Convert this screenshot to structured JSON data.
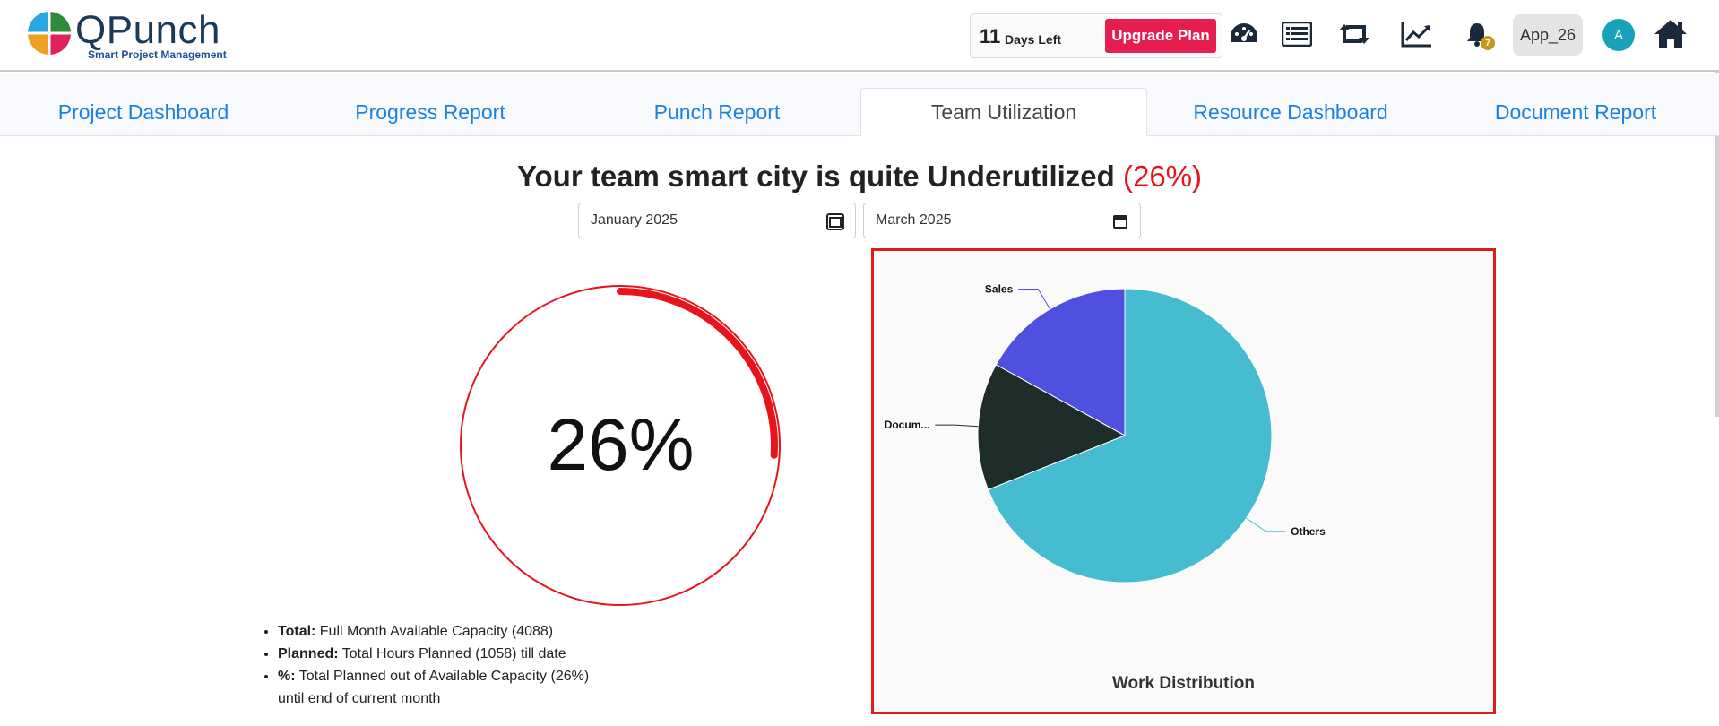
{
  "brand": {
    "name": "QPunch",
    "tagline": "Smart Project Management"
  },
  "trial": {
    "days": "11",
    "days_label": "Days Left",
    "upgrade_label": "Upgrade Plan"
  },
  "header_icons": [
    "dashboard-gauge-icon",
    "list-icon",
    "retweet-icon",
    "trend-chart-icon",
    "bell-icon",
    "home-icon"
  ],
  "notifications": {
    "count": "7"
  },
  "app": {
    "name": "App_26"
  },
  "user": {
    "initial": "A"
  },
  "tabs": [
    {
      "label": "Project Dashboard",
      "active": false
    },
    {
      "label": "Progress Report",
      "active": false
    },
    {
      "label": "Punch Report",
      "active": false
    },
    {
      "label": "Team Utilization",
      "active": true
    },
    {
      "label": "Resource Dashboard",
      "active": false
    },
    {
      "label": "Document Report",
      "active": false
    }
  ],
  "headline": {
    "text": "Your team smart city is quite Underutilized",
    "pct": "(26%)"
  },
  "filters": {
    "start": "January  2025",
    "end": "March  2025"
  },
  "gauge": {
    "value": 26,
    "label": "26%",
    "color": "#e8141c"
  },
  "legend": [
    {
      "key": "Total:",
      "text": " Full Month Available Capacity (4088)"
    },
    {
      "key": "Planned:",
      "text": " Total Hours Planned (1058) till date"
    },
    {
      "key": "%:",
      "text": " Total Planned out of Available Capacity (26%)"
    },
    {
      "key": "",
      "text": "until end of current month"
    }
  ],
  "chart_data": {
    "type": "pie",
    "title": "Work Distribution",
    "slices": [
      {
        "label": "Sales",
        "value": 17,
        "color": "#5050e0"
      },
      {
        "label": "Docum...",
        "value": 14,
        "color": "#1e2d2a"
      },
      {
        "label": "Others",
        "value": 69,
        "color": "#46bcd0"
      }
    ]
  }
}
